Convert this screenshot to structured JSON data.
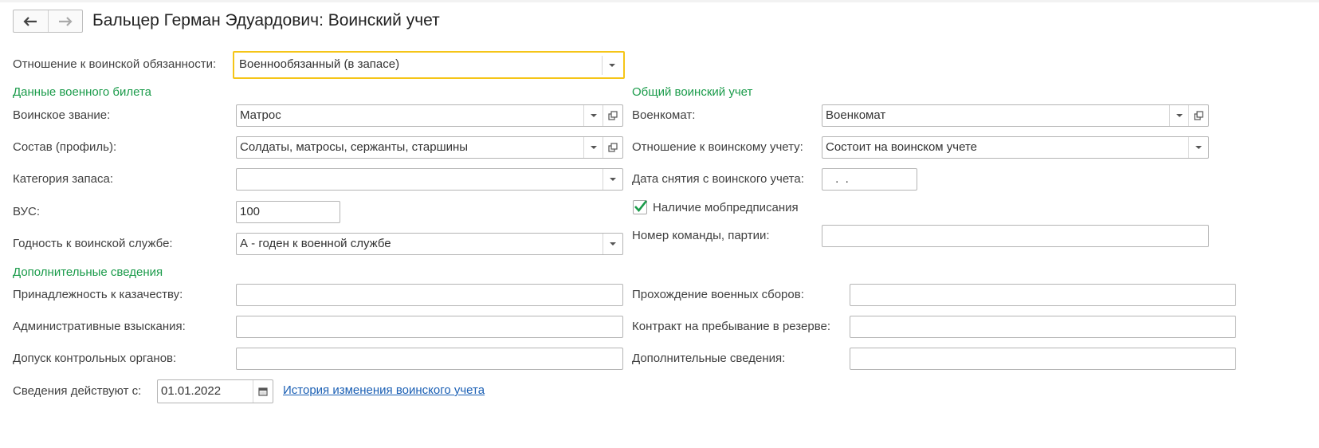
{
  "window": {
    "title": "Бальцер Герман Эдуардович: Воинский учет"
  },
  "nav": {
    "back_icon": "arrow-left-icon",
    "forward_icon": "arrow-right-icon"
  },
  "duty": {
    "label": "Отношение к воинской обязанности:",
    "value": "Военнообязанный (в запасе)"
  },
  "military_id": {
    "section": "Данные военного билета",
    "rank": {
      "label": "Воинское звание:",
      "value": "Матрос"
    },
    "composition": {
      "label": "Состав (профиль):",
      "value": "Солдаты, матросы, сержанты, старшины"
    },
    "reserve_category": {
      "label": "Категория запаса:",
      "value": ""
    },
    "vus": {
      "label": "ВУС:",
      "value": "100"
    },
    "fitness": {
      "label": "Годность к воинской службе:",
      "value": "А - годен к военной службе"
    }
  },
  "general": {
    "section": "Общий воинский учет",
    "commissariat": {
      "label": "Военкомат:",
      "value": "Военкомат"
    },
    "registration": {
      "label": "Отношение к воинскому учету:",
      "value": "Состоит на воинском учете"
    },
    "removal_date": {
      "label": "Дата снятия с воинского учета:",
      "value": " .  ."
    },
    "mob_order": {
      "label": "Наличие мобпредписания",
      "checked": true
    },
    "team_number": {
      "label": "Номер команды, партии:",
      "value": ""
    }
  },
  "additional": {
    "section": "Дополнительные сведения",
    "cossack": {
      "label": "Принадлежность к казачеству:",
      "value": ""
    },
    "admin_penalties": {
      "label": "Административные взыскания:",
      "value": ""
    },
    "access": {
      "label": "Допуск контрольных органов:",
      "value": ""
    },
    "training": {
      "label": "Прохождение военных сборов:",
      "value": ""
    },
    "reserve_contract": {
      "label": "Контракт на пребывание в резерве:",
      "value": ""
    },
    "extra_info": {
      "label": "Дополнительные сведения:",
      "value": ""
    }
  },
  "validity": {
    "label": "Сведения действуют с:",
    "value": "01.01.2022",
    "calendar_icon": "calendar-icon"
  },
  "history_link": "История изменения воинского учета",
  "colors": {
    "section": "#1a9b4a",
    "focus_border": "#f5c518",
    "link": "#1a5fb4",
    "check": "#1a9b4a"
  }
}
